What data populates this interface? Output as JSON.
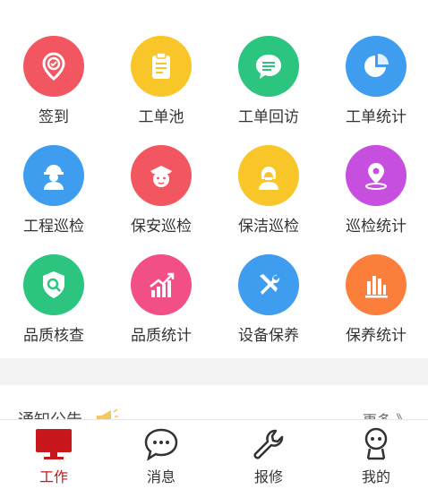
{
  "grid": {
    "items": [
      {
        "label": "签到",
        "icon": "check-in-pin-icon",
        "color": "#f25661"
      },
      {
        "label": "工单池",
        "icon": "clipboard-icon",
        "color": "#f9c62a"
      },
      {
        "label": "工单回访",
        "icon": "chat-bubble-icon",
        "color": "#2cc580"
      },
      {
        "label": "工单统计",
        "icon": "pie-chart-icon",
        "color": "#3f9df0"
      },
      {
        "label": "工程巡检",
        "icon": "worker-helmet-icon",
        "color": "#3f9df0"
      },
      {
        "label": "保安巡检",
        "icon": "security-guard-icon",
        "color": "#f25661"
      },
      {
        "label": "保洁巡检",
        "icon": "cleaner-icon",
        "color": "#f9c62a"
      },
      {
        "label": "巡检统计",
        "icon": "location-pin-icon",
        "color": "#c64fe0"
      },
      {
        "label": "品质核查",
        "icon": "shield-search-icon",
        "color": "#2cc580"
      },
      {
        "label": "品质统计",
        "icon": "bar-trend-icon",
        "color": "#f14f86"
      },
      {
        "label": "设备保养",
        "icon": "tools-icon",
        "color": "#3f9df0"
      },
      {
        "label": "保养统计",
        "icon": "bar-chart-icon",
        "color": "#fb7f3b"
      }
    ]
  },
  "notice": {
    "title": "通知公告",
    "more": "更多 》"
  },
  "tabbar": {
    "items": [
      {
        "label": "工作",
        "icon": "monitor-icon",
        "active": true
      },
      {
        "label": "消息",
        "icon": "message-icon",
        "active": false
      },
      {
        "label": "报修",
        "icon": "wrench-icon",
        "active": false
      },
      {
        "label": "我的",
        "icon": "robot-profile-icon",
        "active": false
      }
    ],
    "active_color": "#c8161d"
  }
}
